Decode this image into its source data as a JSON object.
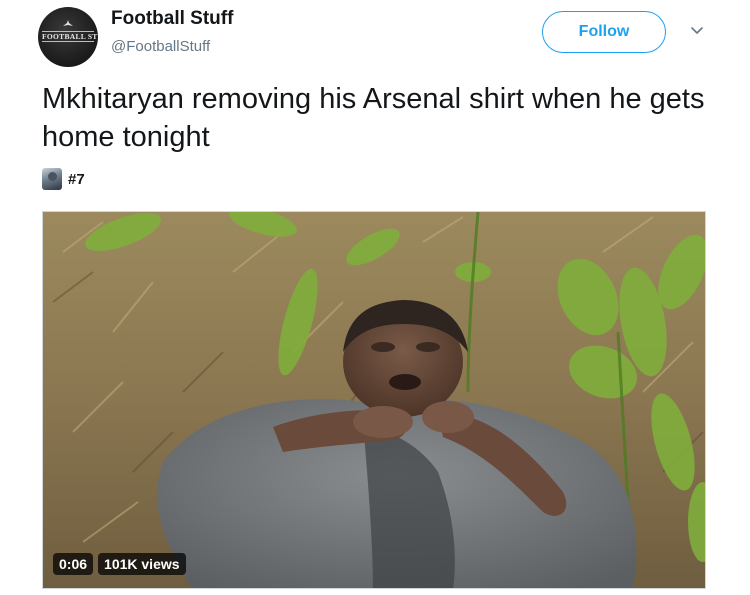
{
  "account": {
    "display_name": "Football Stuff",
    "handle": "@FootballStuff",
    "avatar_text": "FOOTBALL STUFF",
    "follow_label": "Follow"
  },
  "tweet": {
    "text": "Mkhitaryan removing his Arsenal shirt when he gets home tonight",
    "hashtag": "#7"
  },
  "video": {
    "duration": "0:06",
    "views": "101K views"
  },
  "colors": {
    "accent": "#1da1f2",
    "handle_gray": "#657786",
    "text": "#14171a"
  },
  "icons": {
    "menu": "chevron-down-icon"
  }
}
